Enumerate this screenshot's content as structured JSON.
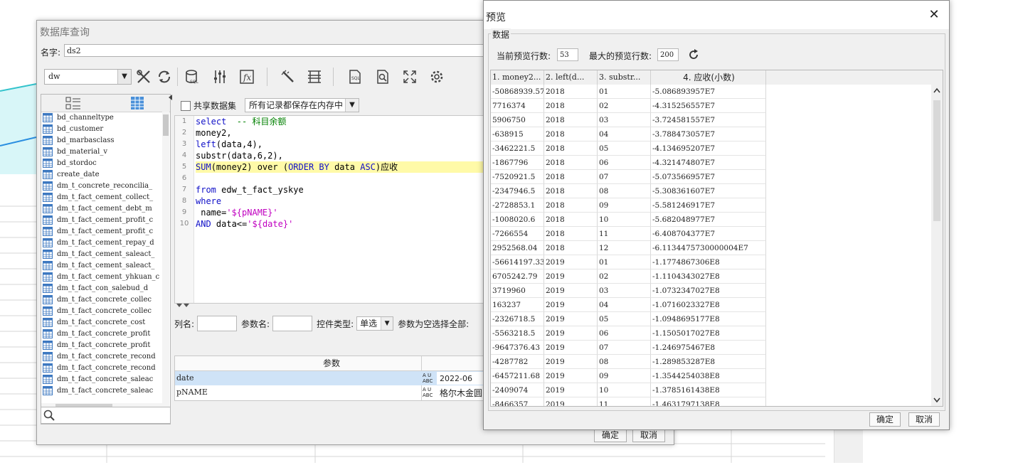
{
  "db_query": {
    "title": "数据库查询",
    "name_label": "名字:",
    "name_value": "ds2",
    "connection": "dw",
    "toolbar_icons": [
      "tools-icon",
      "refresh-icon",
      "sql-database-icon",
      "equalizer-icon",
      "function-icon",
      "magic-wand-icon",
      "table-columns-icon",
      "sql-query-icon",
      "preview-icon",
      "fullscreen-icon",
      "gear-icon"
    ],
    "tables": [
      "bd_channeltype",
      "bd_customer",
      "bd_marbasclass",
      "bd_material_v",
      "bd_stordoc",
      "create_date",
      "dm_t_concrete_reconcilia_",
      "dm_t_fact_cement_collect_",
      "dm_t_fact_cement_debt_m",
      "dm_t_fact_cement_profit_c",
      "dm_t_fact_cement_profit_c",
      "dm_t_fact_cement_repay_d",
      "dm_t_fact_cement_saleact_",
      "dm_t_fact_cement_saleact_",
      "dm_t_fact_cement_yhkuan_c",
      "dm_t_fact_con_salebud_d",
      "dm_t_fact_concrete_collec",
      "dm_t_fact_concrete_collec",
      "dm_t_fact_concrete_cost",
      "dm_t_fact_concrete_profit",
      "dm_t_fact_concrete_profit",
      "dm_t_fact_concrete_recond",
      "dm_t_fact_concrete_recond",
      "dm_t_fact_concrete_saleac",
      "dm_t_fact_concrete_saleac"
    ],
    "share_label": "共享数据集",
    "memory_option": "所有记录都保存在内存中",
    "line_numbers": [
      "1",
      "2",
      "3",
      "4",
      "5",
      "6",
      "7",
      "8",
      "9",
      "10"
    ],
    "code": {
      "l1_kw": "select",
      "l1_cm": "  -- 科目余额",
      "l2": "money2,",
      "l3_kw": "left",
      "l3_rest": "(data,4),",
      "l4": "substr(data,6,2),",
      "l5_kw1": "SUM",
      "l5_mid1": "(money2) over (",
      "l5_kw2": "ORDER BY",
      "l5_mid2": " data ",
      "l5_kw3": "ASC",
      "l5_end": ")应收",
      "l7_kw": "from",
      "l7_rest": " edw_t_fact_yskye",
      "l8_kw": "where",
      "l9_pre": " name=",
      "l9_str": "'${pNAME}'",
      "l10_kw": "AND",
      "l10_mid": " data<=",
      "l10_str": "'${date}'"
    },
    "col_name_label": "列名:",
    "param_name_label": "参数名:",
    "control_type_label": "控件类型:",
    "control_type_value": "单选",
    "empty_select_label": "参数为空选择全部:",
    "params_header": "参数",
    "params": [
      {
        "name": "date",
        "value": "2022-06"
      },
      {
        "name": "pNAME",
        "value": "格尔木金圆"
      }
    ],
    "abc_label": "ABC",
    "ok": "确定",
    "cancel": "取消"
  },
  "preview": {
    "title": "预览",
    "group_label": "数据",
    "current_rows_label": "当前预览行数:",
    "current_rows": "53",
    "max_rows_label": "最大的预览行数:",
    "max_rows": "200",
    "columns": [
      "1. money2...",
      "2. left(d...",
      "3. substr...",
      "4. 应收(小数)"
    ],
    "rows": [
      [
        "-50868939.57",
        "2018",
        "01",
        "-5.086893957E7"
      ],
      [
        "7716374",
        "2018",
        "02",
        "-4.315256557E7"
      ],
      [
        "5906750",
        "2018",
        "03",
        "-3.724581557E7"
      ],
      [
        "-638915",
        "2018",
        "04",
        "-3.788473057E7"
      ],
      [
        "-3462221.5",
        "2018",
        "05",
        "-4.134695207E7"
      ],
      [
        "-1867796",
        "2018",
        "06",
        "-4.321474807E7"
      ],
      [
        "-7520921.5",
        "2018",
        "07",
        "-5.073566957E7"
      ],
      [
        "-2347946.5",
        "2018",
        "08",
        "-5.308361607E7"
      ],
      [
        "-2728853.1",
        "2018",
        "09",
        "-5.581246917E7"
      ],
      [
        "-1008020.6",
        "2018",
        "10",
        "-5.682048977E7"
      ],
      [
        "-7266554",
        "2018",
        "11",
        "-6.408704377E7"
      ],
      [
        "2952568.04",
        "2018",
        "12",
        "-6.1134475730000004E7"
      ],
      [
        "-56614197.33",
        "2019",
        "01",
        "-1.1774867306E8"
      ],
      [
        "6705242.79",
        "2019",
        "02",
        "-1.1104343027E8"
      ],
      [
        "3719960",
        "2019",
        "03",
        "-1.0732347027E8"
      ],
      [
        "163237",
        "2019",
        "04",
        "-1.0716023327E8"
      ],
      [
        "-2326718.5",
        "2019",
        "05",
        "-1.0948695177E8"
      ],
      [
        "-5563218.5",
        "2019",
        "06",
        "-1.1505017027E8"
      ],
      [
        "-9647376.43",
        "2019",
        "07",
        "-1.246975467E8"
      ],
      [
        "-4287782",
        "2019",
        "08",
        "-1.289853287E8"
      ],
      [
        "-6457211.68",
        "2019",
        "09",
        "-1.3544254038E8"
      ],
      [
        "-2409074",
        "2019",
        "10",
        "-1.3785161438E8"
      ],
      [
        "-8466357",
        "2019",
        "11",
        "-1.4631797138E8"
      ]
    ],
    "ok": "确定",
    "cancel": "取消"
  },
  "colors": {
    "editor_highlight": "#fffaa8",
    "keyword": "#1010c8",
    "comment": "#008000",
    "string": "#c000c0",
    "selected_param_row": "#cfe3f7"
  }
}
